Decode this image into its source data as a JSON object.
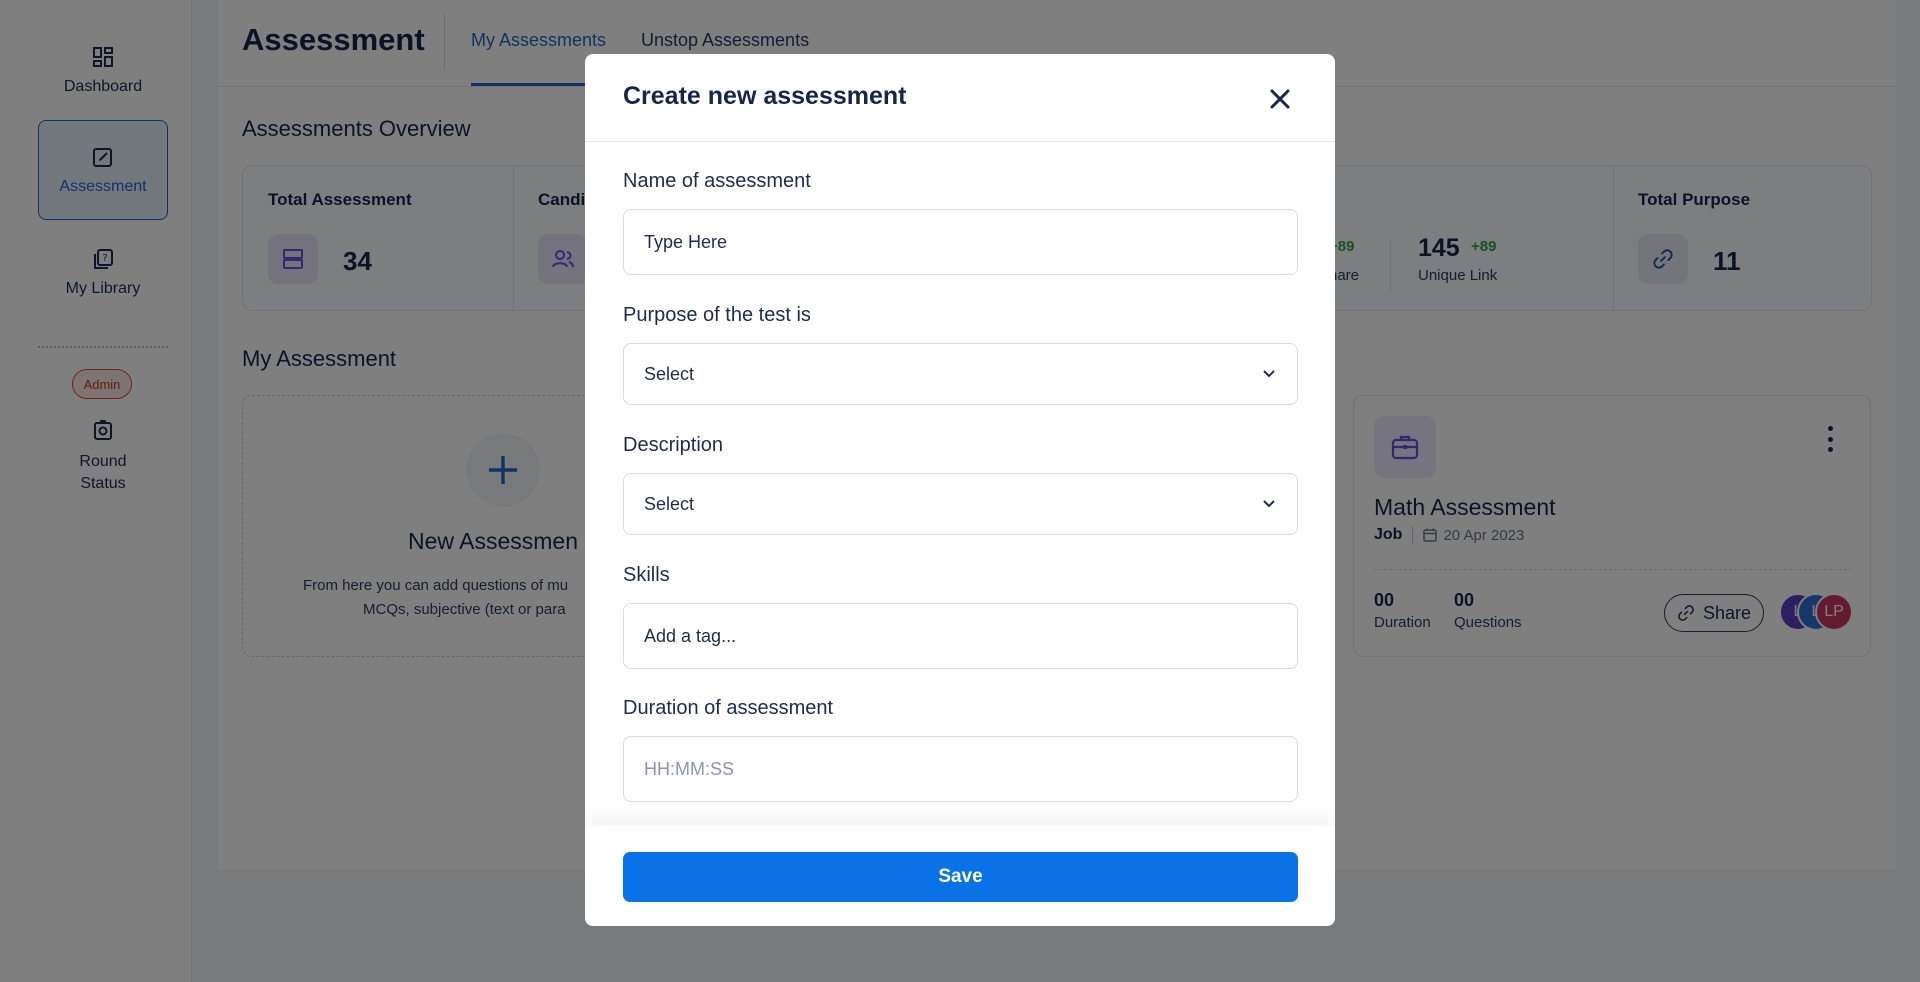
{
  "sidebar": {
    "items": [
      {
        "label": "Dashboard",
        "icon": "dashboard-icon"
      },
      {
        "label": "Assessment",
        "icon": "assessment-icon",
        "active": true
      },
      {
        "label": "My Library",
        "icon": "library-icon"
      }
    ],
    "admin_badge": "Admin",
    "round_status": {
      "line1": "Round",
      "line2": "Status"
    }
  },
  "header": {
    "title": "Assessment",
    "tabs": [
      {
        "label": "My Assessments",
        "active": true
      },
      {
        "label": "Unstop Assessments"
      }
    ]
  },
  "overview": {
    "title": "Assessments Overview",
    "total_assessment": {
      "label": "Total Assessment",
      "value": "34"
    },
    "candidates": {
      "label": "Candi"
    },
    "share": {
      "delta": "+89",
      "label": "hare"
    },
    "unique_link": {
      "value": "145",
      "delta": "+89",
      "label": "Unique Link"
    },
    "total_purpose": {
      "label": "Total Purpose",
      "value": "11"
    }
  },
  "my_assessment": {
    "title": "My Assessment",
    "new_card": {
      "title": "New Assessmen",
      "desc_line1": "From here you can add questions of mu",
      "desc_line2": "MCQs, subjective (text or para"
    },
    "math_card": {
      "title": "Math Assessment",
      "type": "Job",
      "date": "20 Apr 2023",
      "duration_value": "00",
      "duration_label": "Duration",
      "questions_value": "00",
      "questions_label": "Questions",
      "share_label": "Share",
      "avatars": [
        {
          "initials": "L",
          "color": "#5b3cc4"
        },
        {
          "initials": "L",
          "color": "#2f6fd0"
        },
        {
          "initials": "LP",
          "color": "#c8365f"
        }
      ]
    }
  },
  "modal": {
    "title": "Create new assessment",
    "name_label": "Name of assessment",
    "name_placeholder": "Type Here",
    "purpose_label": "Purpose of the test is",
    "purpose_value": "Select",
    "description_label": "Description",
    "description_value": "Select",
    "skills_label": "Skills",
    "skills_placeholder": "Add a tag...",
    "duration_label": "Duration of assessment",
    "duration_placeholder": "HH:MM:SS",
    "save_label": "Save"
  },
  "colors": {
    "primary": "#0872e6",
    "accent": "#1f67c9",
    "heading": "#15264d",
    "admin": "#e14b2a",
    "success": "#2f9e4b"
  }
}
